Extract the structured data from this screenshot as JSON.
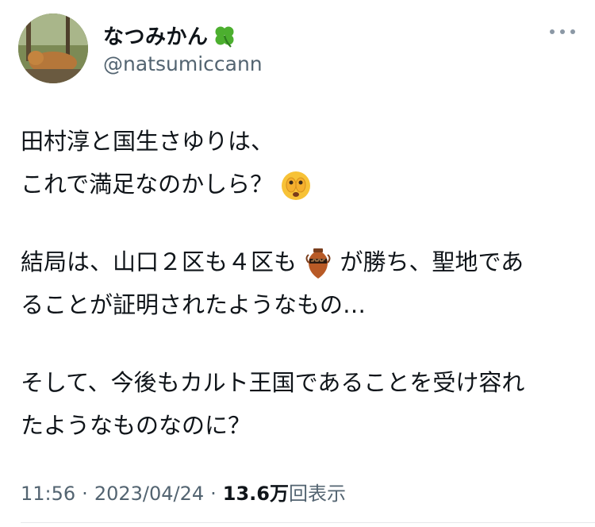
{
  "author": {
    "display_name": "なつみかん",
    "handle": "@natsumiccann",
    "name_emoji": "four-leaf-clover-icon"
  },
  "tweet": {
    "lines": [
      "田村淳と国生さゆりは、",
      "これで満足なのかしら？",
      "結局は、山口２区も４区も",
      "が勝ち、聖地であ",
      "ることが証明されたようなもの…",
      "そして、今後もカルト王国であることを受け容れ",
      "たようなものなのに？"
    ],
    "emojis": [
      "face-with-peeking-eye-icon",
      "amphora-icon"
    ]
  },
  "meta": {
    "time": "11:56",
    "date": "2023/04/24",
    "views_count": "13.6万",
    "views_label": "回表示",
    "separator": "·"
  },
  "colors": {
    "text": "#0f1419",
    "secondary": "#536471"
  }
}
